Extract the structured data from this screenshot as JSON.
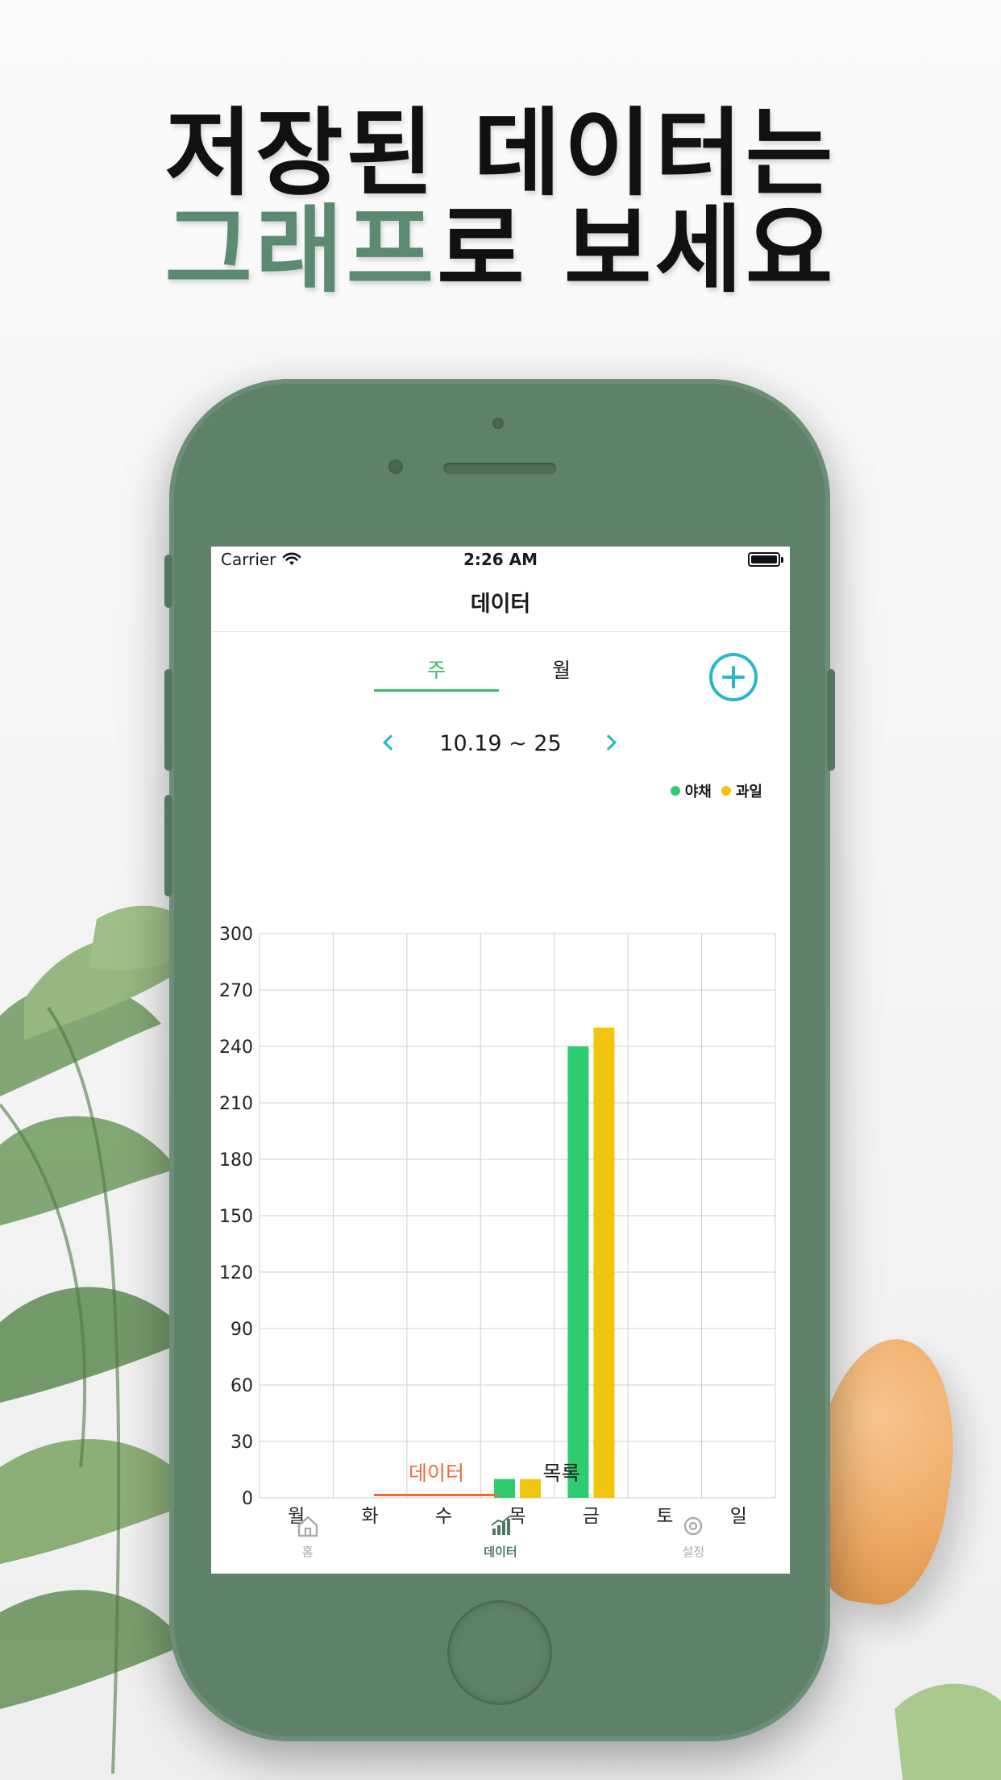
{
  "headline": {
    "line1": "저장된 데이터는",
    "line2_accent": "그래프",
    "line2_rest": "로 보세요"
  },
  "colors": {
    "accent": "#5a8a70",
    "phone": "#5f8169",
    "vegetable": "#2ecc71",
    "fruit": "#f1c40f",
    "teal": "#25b9c8",
    "orange": "#f06a35"
  },
  "status": {
    "carrier": "Carrier",
    "time": "2:26 AM"
  },
  "nav": {
    "title": "데이터"
  },
  "period_tabs": [
    {
      "label": "주",
      "active": true
    },
    {
      "label": "월",
      "active": false
    }
  ],
  "range": {
    "label": "10.19 ~ 25"
  },
  "view_tabs": [
    {
      "label": "데이터",
      "active": true
    },
    {
      "label": "목록",
      "active": false
    }
  ],
  "tabbar": [
    {
      "label": "홈",
      "icon": "home-icon",
      "active": false
    },
    {
      "label": "데이터",
      "icon": "bar-chart-icon",
      "active": true
    },
    {
      "label": "설정",
      "icon": "gear-icon",
      "active": false
    }
  ],
  "chart_data": {
    "type": "bar",
    "categories": [
      "월",
      "화",
      "수",
      "목",
      "금",
      "토",
      "일"
    ],
    "series": [
      {
        "name": "야채",
        "color": "#2ecc71",
        "values": [
          0,
          0,
          0,
          10,
          240,
          0,
          0
        ]
      },
      {
        "name": "과일",
        "color": "#f1c40f",
        "values": [
          0,
          0,
          0,
          10,
          250,
          0,
          0
        ]
      }
    ],
    "ylim": [
      0,
      300
    ],
    "yticks": [
      0,
      30,
      60,
      90,
      120,
      150,
      180,
      210,
      240,
      270,
      300
    ],
    "grid": true,
    "legend": "top-right"
  }
}
